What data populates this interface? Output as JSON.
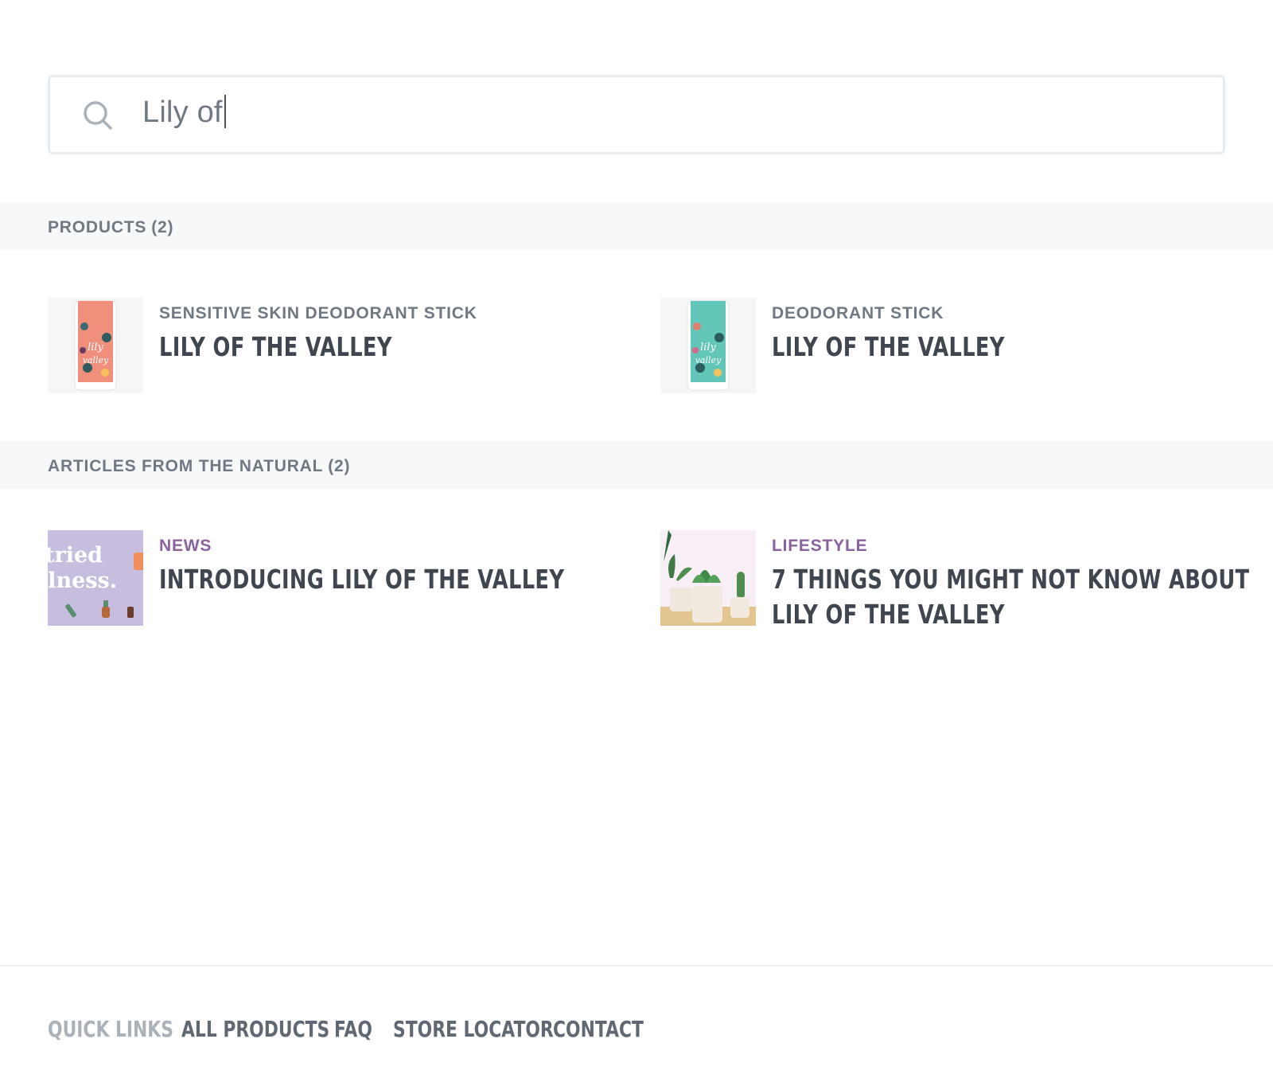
{
  "search": {
    "value": "Lily of"
  },
  "products_section": {
    "title": "PRODUCTS",
    "count": "(2)",
    "items": [
      {
        "category": "SENSITIVE SKIN DEODORANT STICK",
        "name": "LILY OF THE VALLEY",
        "thumb_color": "#f08f7c"
      },
      {
        "category": "DEODORANT STICK",
        "name": "LILY OF THE VALLEY",
        "thumb_color": "#62c6b9"
      }
    ]
  },
  "articles_section": {
    "title": "ARTICLES FROM THE NATURAL",
    "count": "(2)",
    "items": [
      {
        "category": "NEWS",
        "name": "INTRODUCING LILY OF THE VALLEY",
        "thumb_text_1": "tried",
        "thumb_text_2": "llness."
      },
      {
        "category": "LIFESTYLE",
        "name_line1": "7 THINGS YOU MIGHT NOT KNOW ABOUT",
        "name_line2": "LILY OF THE VALLEY"
      }
    ]
  },
  "footer": {
    "quick_links_label": "QUICK LINKS",
    "links": [
      "ALL PRODUCTS",
      "FAQ",
      "STORE LOCATOR",
      "CONTACT"
    ]
  },
  "colors": {
    "accent_purple": "#8a619e",
    "text_dark": "#3f464f",
    "text_muted": "#6f7883",
    "section_bg": "#f7f8fa"
  }
}
